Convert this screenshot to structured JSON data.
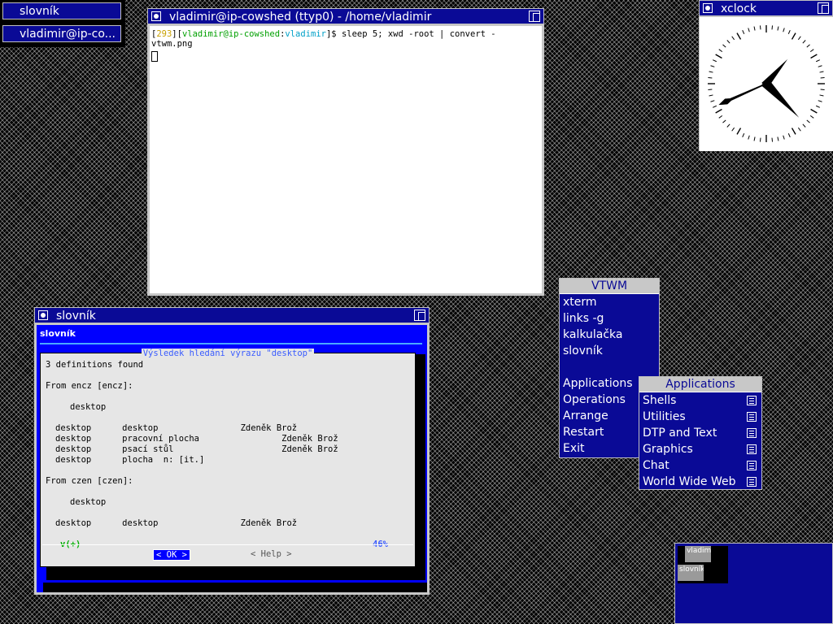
{
  "icon_manager": {
    "items": [
      {
        "label": "slovník"
      },
      {
        "label": "vladimir@ip-co..."
      }
    ]
  },
  "xterm": {
    "title": "vladimir@ip-cowshed (ttyp0) - /home/vladimir",
    "prompt": {
      "open": "[",
      "number": "293",
      "mid": "][",
      "user": "vladimir",
      "at": "@",
      "host": "ip-cowshed",
      "colon": ":",
      "dir": "vladimir",
      "close": "]$ ",
      "command": "sleep 5; xwd -root | convert - vtwm.png"
    }
  },
  "xclock": {
    "title": "xclock",
    "time": {
      "hours": 1,
      "minutes": 22,
      "seconds": 41
    }
  },
  "slovnik": {
    "title": "slovník",
    "inner_title": "slovník",
    "dialog_heading": "Výsledek hledání výrazu \"desktop\"",
    "lines": [
      "3 definitions found",
      "From encz [encz]:",
      "desktop",
      "desktop      desktop                Zdeněk Brož",
      "desktop      pracovní plocha                Zdeněk Brož",
      "desktop      psací stůl                     Zdeněk Brož",
      "desktop      plocha  n: [it.]",
      "From czen [czen]:",
      "desktop",
      "desktop      desktop                Zdeněk Brož"
    ],
    "scroll_indicator": "v(+)",
    "percent": "46%",
    "ok_label": "< OK >",
    "help_label": "< Help >"
  },
  "vtwm_menu": {
    "title": "VTWM",
    "items": [
      {
        "label": "xterm"
      },
      {
        "label": "links -g"
      },
      {
        "label": "kalkulačka"
      },
      {
        "label": "slovník"
      },
      {
        "label": ""
      },
      {
        "label": "Applications"
      },
      {
        "label": "Operations"
      },
      {
        "label": "Arrange"
      },
      {
        "label": "Restart"
      },
      {
        "label": "Exit"
      }
    ]
  },
  "applications_menu": {
    "title": "Applications",
    "items": [
      {
        "label": "Shells"
      },
      {
        "label": "Utilities"
      },
      {
        "label": "DTP and Text"
      },
      {
        "label": "Graphics"
      },
      {
        "label": "Chat"
      },
      {
        "label": "World Wide Web"
      }
    ]
  },
  "pager": {
    "windows": [
      {
        "label": "vladim"
      },
      {
        "label": "slovník"
      }
    ]
  },
  "colors": {
    "title_bar": "#0a0a96",
    "prompt_number": "#c8a000",
    "prompt_user": "#00a000",
    "prompt_host": "#00a000",
    "prompt_dir": "#00a0c8",
    "dialog_accent": "#3a5cff"
  }
}
